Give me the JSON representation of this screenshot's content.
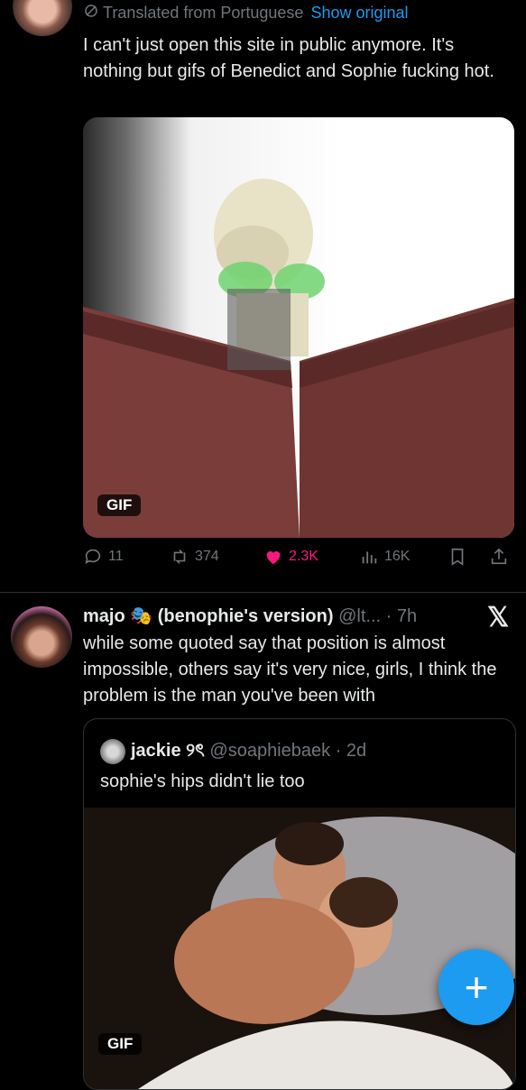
{
  "tweet1": {
    "translated_label": "Translated from Portuguese",
    "show_original": "Show original",
    "text": "I can't just open this site in public anymore. It's nothing but gifs of Benedict and Sophie fucking hot.",
    "gif_label": "GIF",
    "actions": {
      "replies": "11",
      "retweets": "374",
      "likes": "2.3K",
      "views": "16K"
    }
  },
  "tweet2": {
    "name": "majo",
    "name_suffix": "(benophie's version)",
    "handle_time": "@lt... · 7h",
    "text": "while some quoted say that position is almost impossible, others say it's very nice, girls, I think the problem is the man you've been with",
    "quote": {
      "name": "jackie",
      "name_glyph": "୨ৎ",
      "handle_time": "@soaphiebaek · 2d",
      "text": "sophie's hips didn't lie too",
      "gif_label": "GIF"
    }
  },
  "fab_label": "+",
  "colors": {
    "accent": "#1d9bf0",
    "like": "#f91880",
    "muted": "#71767b"
  }
}
